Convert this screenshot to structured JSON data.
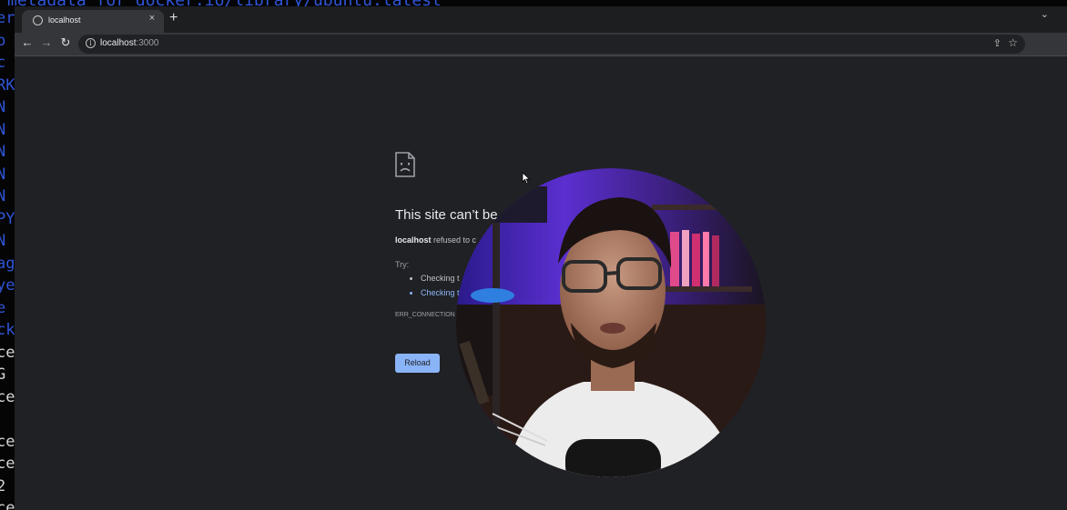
{
  "terminal": {
    "top_line": "metadata for docker.io/library/ubuntu:latest",
    "left_fragments": [
      {
        "text": "er",
        "color": "blue"
      },
      {
        "text": "b",
        "color": "blue"
      },
      {
        "text": "c",
        "color": "blue"
      },
      {
        "text": "RK",
        "color": "blue"
      },
      {
        "text": "N",
        "color": "blue"
      },
      {
        "text": "N",
        "color": "blue"
      },
      {
        "text": "N",
        "color": "blue"
      },
      {
        "text": "N",
        "color": "blue"
      },
      {
        "text": "N",
        "color": "blue"
      },
      {
        "text": "PY",
        "color": "blue"
      },
      {
        "text": "N",
        "color": "blue"
      },
      {
        "text": "ag",
        "color": "blue"
      },
      {
        "text": "ye",
        "color": "blue"
      },
      {
        "text": "e",
        "color": "blue"
      },
      {
        "text": "ck",
        "color": "blue"
      },
      {
        "text": "ce",
        "color": "white"
      },
      {
        "text": "G",
        "color": "white"
      },
      {
        "text": "ce",
        "color": "white"
      },
      {
        "text": "",
        "color": "white"
      },
      {
        "text": "ce",
        "color": "white"
      },
      {
        "text": "ce",
        "color": "white"
      },
      {
        "text": "2",
        "color": "white"
      },
      {
        "text": "ce",
        "color": "white"
      }
    ]
  },
  "browser": {
    "tab": {
      "title": "localhost",
      "close": "×"
    },
    "new_tab": "+",
    "tab_search": "⌄",
    "nav": {
      "back": "←",
      "forward": "→",
      "reload": "↻"
    },
    "address": {
      "host": "localhost",
      "port": ":3000",
      "info": "i"
    },
    "address_actions": {
      "share": "⇪",
      "star": "☆"
    },
    "extensions_icon": "✱"
  },
  "error_page": {
    "title": "This site can’t be",
    "description_host": "localhost",
    "description_rest": " refused to c",
    "try_label": "Try:",
    "suggestions": [
      "Checking t",
      "Checking t"
    ],
    "error_code": "ERR_CONNECTION",
    "reload_label": "Reload"
  },
  "colors": {
    "terminal_blue": "#2f55d8",
    "page_bg": "#202124",
    "link": "#8ab4f8",
    "button": "#8ab4f8"
  }
}
